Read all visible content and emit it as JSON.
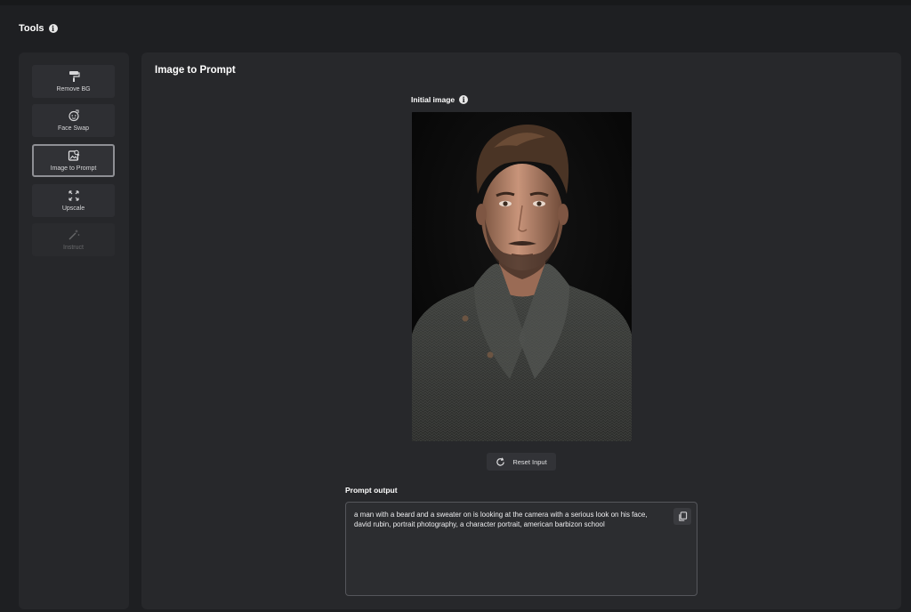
{
  "header": {
    "title": "Tools",
    "info_icon": "info-icon"
  },
  "sidebar": {
    "items": [
      {
        "label": "Remove BG",
        "icon": "paint-roller-icon",
        "state": "normal"
      },
      {
        "label": "Face Swap",
        "icon": "face-swap-icon",
        "state": "normal"
      },
      {
        "label": "Image to Prompt",
        "icon": "image-search-icon",
        "state": "active"
      },
      {
        "label": "Upscale",
        "icon": "expand-arrows-icon",
        "state": "normal"
      },
      {
        "label": "Instruct",
        "icon": "magic-wand-icon",
        "state": "disabled"
      }
    ]
  },
  "main": {
    "title": "Image to Prompt",
    "initial_image_label": "Initial image",
    "reset_label": "Reset Input",
    "prompt_output_label": "Prompt output",
    "prompt_output": "a man with a beard and a sweater on is looking at the camera with a serious look on his face, david rubin, portrait photography, a character portrait, american barbizon school"
  },
  "colors": {
    "background": "#1e1f22",
    "panel": "#27282b",
    "button": "#2e2f33",
    "active_border": "#8e8f94",
    "text": "#f2f2f2"
  }
}
